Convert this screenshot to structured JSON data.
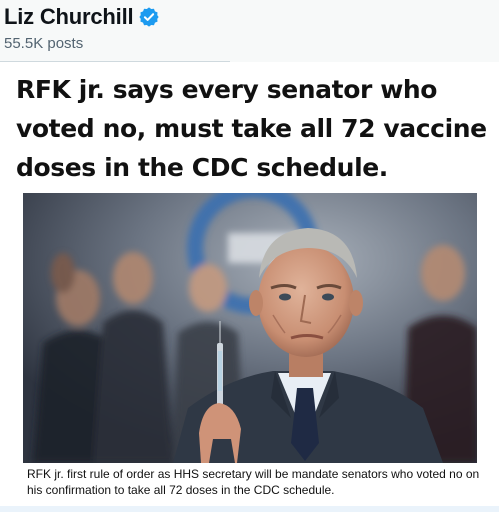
{
  "account": {
    "display_name": "Liz Churchill",
    "post_count": "55.5K posts",
    "verified_color": "#1d9bf0"
  },
  "post": {
    "headline": "RFK jr. says every senator who voted no, must take all 72 vaccine doses in the CDC schedule.",
    "caption": "RFK jr. first rule of order as HHS secretary  will be mandate senators who voted no on his confirmation to take all 72 doses in the CDC schedule."
  }
}
